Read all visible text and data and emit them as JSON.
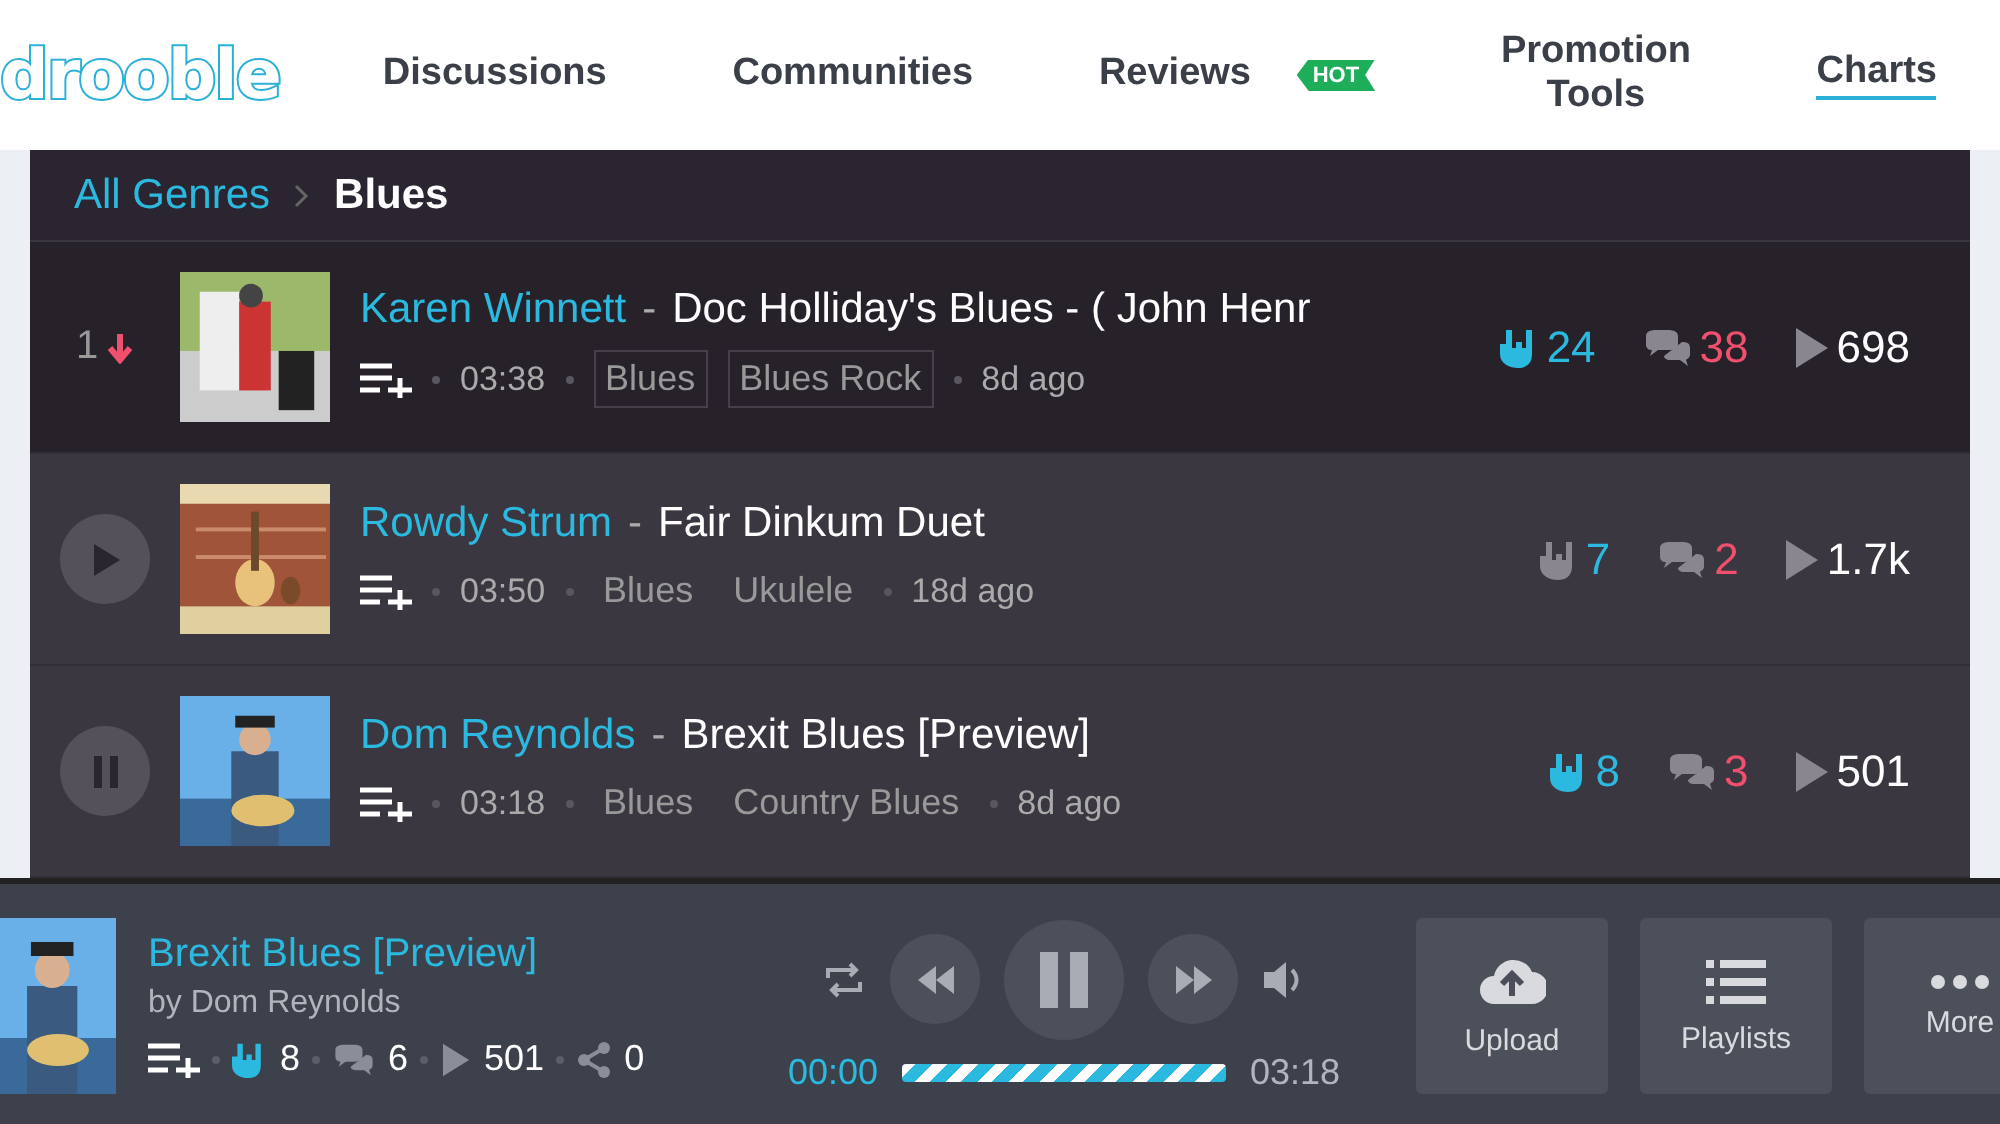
{
  "header": {
    "logo": "drooble",
    "nav": [
      {
        "label": "Discussions",
        "selected": false
      },
      {
        "label": "Communities",
        "selected": false
      },
      {
        "label": "Reviews",
        "selected": false,
        "badge": "HOT"
      },
      {
        "label": "Promotion Tools",
        "selected": false
      },
      {
        "label": "Charts",
        "selected": true
      }
    ]
  },
  "breadcrumb": [
    "All Genres",
    "Blues"
  ],
  "tracks": [
    {
      "control": {
        "kind": "rank",
        "rank": "1",
        "falling": true
      },
      "highlighted": false,
      "artist": "Karen Winnett",
      "separator": "-",
      "title": "Doc Holliday's Blues - ( John Henr",
      "duration": "03:38",
      "tags": [
        "Blues",
        "Blues Rock"
      ],
      "tags_boxed": true,
      "age": "8d ago",
      "liked": true,
      "likes": "24",
      "comments": "38",
      "plays": "698"
    },
    {
      "control": {
        "kind": "play"
      },
      "highlighted": true,
      "artist": "Rowdy Strum",
      "separator": "-",
      "title": "Fair Dinkum Duet",
      "duration": "03:50",
      "tags": [
        "Blues",
        "Ukulele"
      ],
      "tags_boxed": false,
      "age": "18d ago",
      "liked": false,
      "likes": "7",
      "comments": "2",
      "plays": "1.7k"
    },
    {
      "control": {
        "kind": "pause"
      },
      "highlighted": true,
      "artist": "Dom Reynolds",
      "separator": "-",
      "title": "Brexit Blues [Preview]",
      "duration": "03:18",
      "tags": [
        "Blues",
        "Country Blues"
      ],
      "tags_boxed": false,
      "age": "8d ago",
      "liked": true,
      "likes": "8",
      "comments": "3",
      "plays": "501"
    }
  ],
  "player": {
    "title": "Brexit Blues [Preview]",
    "artist": "by Dom Reynolds",
    "liked": true,
    "likes": "8",
    "comments": "6",
    "plays": "501",
    "shares": "0",
    "elapsed": "00:00",
    "total": "03:18",
    "playing": true,
    "buffer": {
      "level": 1
    },
    "actions": [
      {
        "label": "Upload",
        "kind": "upload"
      },
      {
        "label": "Playlists",
        "kind": "playlists"
      },
      {
        "label": "More",
        "kind": "more"
      }
    ]
  }
}
